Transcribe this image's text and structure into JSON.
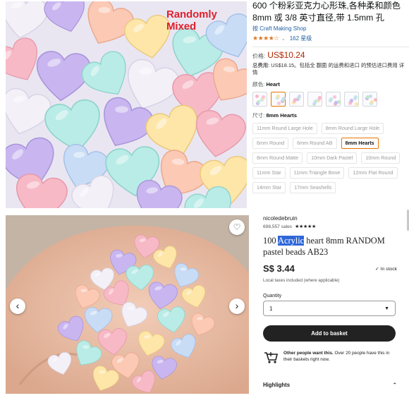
{
  "top_image": {
    "overlay_text": "Randomly Mixed"
  },
  "top_product": {
    "title": "600 个粉彩亚克力心形珠,各种柔和颜色 8mm 或 3/8 英寸直径,带 1.5mm 孔",
    "brand": "按 Craft Making Shop",
    "stars": "★★★★☆",
    "rating_count": "162 星级",
    "price_label": "价格:",
    "price": "US$10.24",
    "shipping_label": "总费用:",
    "shipping_text": "US$18.15。包括全 翻面 的运费和进口 的预估进口费用 详情",
    "color_label": "颜色:",
    "color_value": "Heart",
    "size_label": "尺寸:",
    "size_value": "8mm Hearts",
    "size_options": [
      "11mm Round Large Hole",
      "8mm Round Large Hole",
      "6mm Round",
      "6mm Round AB",
      "8mm Hearts",
      "8mm Round Matte",
      "10mm Dark Pastel",
      "10mm Round",
      "11mm Star",
      "11mm Triangle Bone",
      "12mm Flat Round",
      "14mm Star",
      "17mm Seashells"
    ],
    "selected_size_index": 4
  },
  "bottom_product": {
    "seller": "nicoledebruin",
    "sales": "698,557 sales",
    "stars": "★★★★★",
    "title_prefix": "100 ",
    "title_highlight": "Acrylic",
    "title_rest": " heart 8mm RANDOM pastel beads AB23",
    "price": "S$ 3.44",
    "stock": "In stock",
    "tax_note": "Local taxes included (where applicable)",
    "quantity_label": "Quantity",
    "quantity_value": "1",
    "add_button": "Add to basket",
    "demand_bold": "Other people want this.",
    "demand_text": " Over 20 people have this in their baskets right now.",
    "highlights": "Highlights"
  },
  "colors": {
    "amazon_orange": "#e77600",
    "price_red": "#b12704",
    "etsy_dark": "#222222",
    "highlight_blue": "#2f67d8"
  }
}
